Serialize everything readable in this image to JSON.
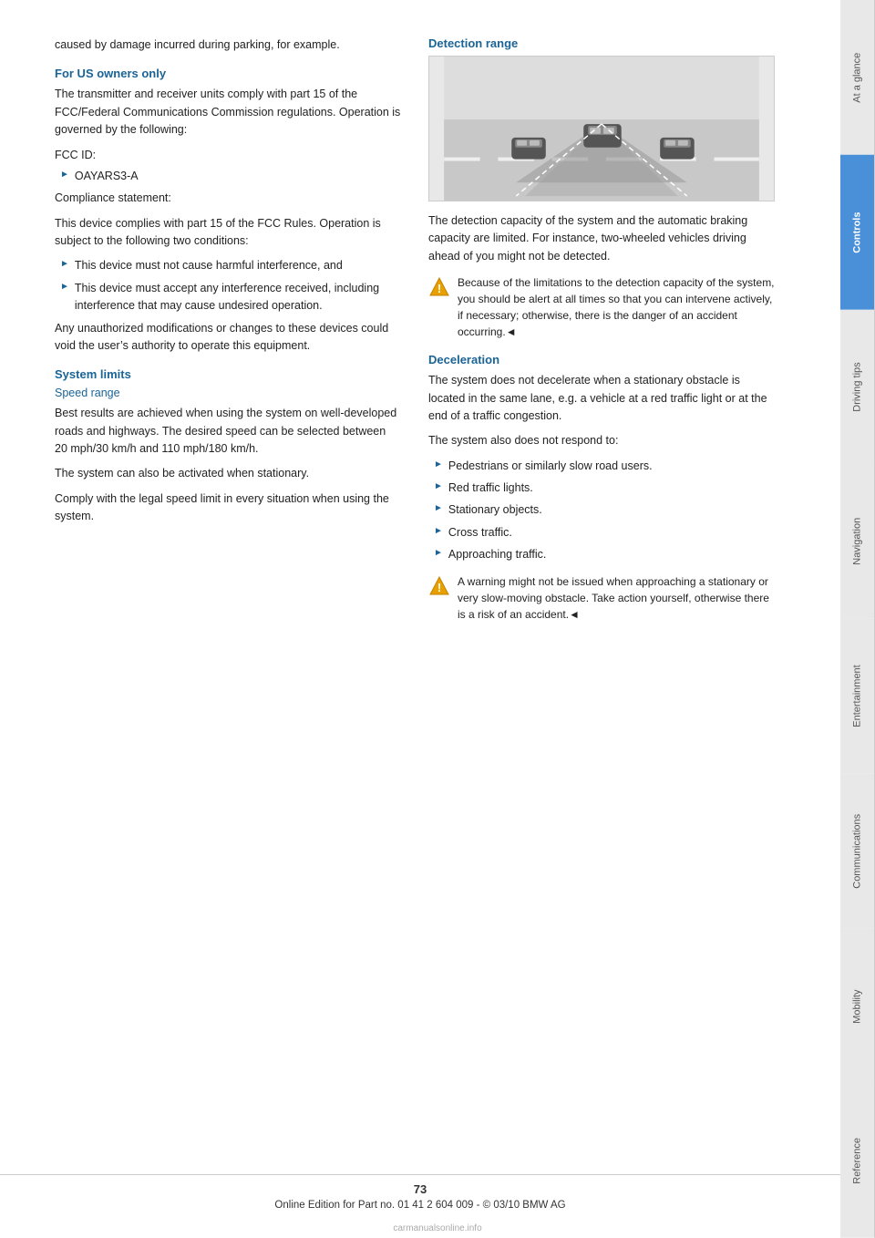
{
  "page": {
    "number": "73",
    "footer_text": "Online Edition for Part no. 01 41 2 604 009 - © 03/10 BMW AG"
  },
  "side_tabs": [
    {
      "id": "at-a-glance",
      "label": "At a glance",
      "active": false
    },
    {
      "id": "controls",
      "label": "Controls",
      "active": true
    },
    {
      "id": "driving-tips",
      "label": "Driving tips",
      "active": false
    },
    {
      "id": "navigation",
      "label": "Navigation",
      "active": false
    },
    {
      "id": "entertainment",
      "label": "Entertainment",
      "active": false
    },
    {
      "id": "communications",
      "label": "Communications",
      "active": false
    },
    {
      "id": "mobility",
      "label": "Mobility",
      "active": false
    },
    {
      "id": "reference",
      "label": "Reference",
      "active": false
    }
  ],
  "left_column": {
    "intro_text": "caused by damage incurred during parking, for example.",
    "for_us_owners": {
      "heading": "For US owners only",
      "para1": "The transmitter and receiver units comply with part 15 of the FCC/Federal Communications Commission regulations. Operation is governed by the following:",
      "fcc_id_label": "FCC ID:",
      "fcc_id_value": "OAYARS3-A",
      "compliance_label": "Compliance statement:",
      "compliance_text": "This device complies with part 15 of the FCC Rules. Operation is subject to the following two conditions:",
      "bullets": [
        "This device must not cause harmful interference, and",
        "This device must accept any interference received, including interference that may cause undesired operation."
      ],
      "modifications_text": "Any unauthorized modifications or changes to these devices could void the user’s authority to operate this equipment."
    },
    "system_limits": {
      "heading": "System limits",
      "speed_range": {
        "subheading": "Speed range",
        "para1": "Best results are achieved when using the system on well-developed roads and highways. The desired speed can be selected between 20 mph/30 km/h and 110 mph/180 km/h.",
        "para2": "The system can also be activated when stationary.",
        "para3": "Comply with the legal speed limit in every situation when using the system."
      }
    }
  },
  "right_column": {
    "detection_range": {
      "heading": "Detection range",
      "para1": "The detection capacity of the system and the automatic braking capacity are limited. For instance, two-wheeled vehicles driving ahead of you might not be detected.",
      "warning_text": "Because of the limitations to the detection capacity of the system, you should be alert at all times so that you can intervene actively, if necessary; otherwise, there is the danger of an accident occurring.◄"
    },
    "deceleration": {
      "heading": "Deceleration",
      "para1": "The system does not decelerate when a stationary obstacle is located in the same lane, e.g. a vehicle at a red traffic light or at the end of a traffic congestion.",
      "para2": "The system also does not respond to:",
      "bullets": [
        "Pedestrians or similarly slow road users.",
        "Red traffic lights.",
        "Stationary objects.",
        "Cross traffic.",
        "Approaching traffic."
      ],
      "warning_text": "A warning might not be issued when approaching a stationary or very slow-moving obstacle. Take action yourself, otherwise there is a risk of an accident.◄"
    }
  }
}
